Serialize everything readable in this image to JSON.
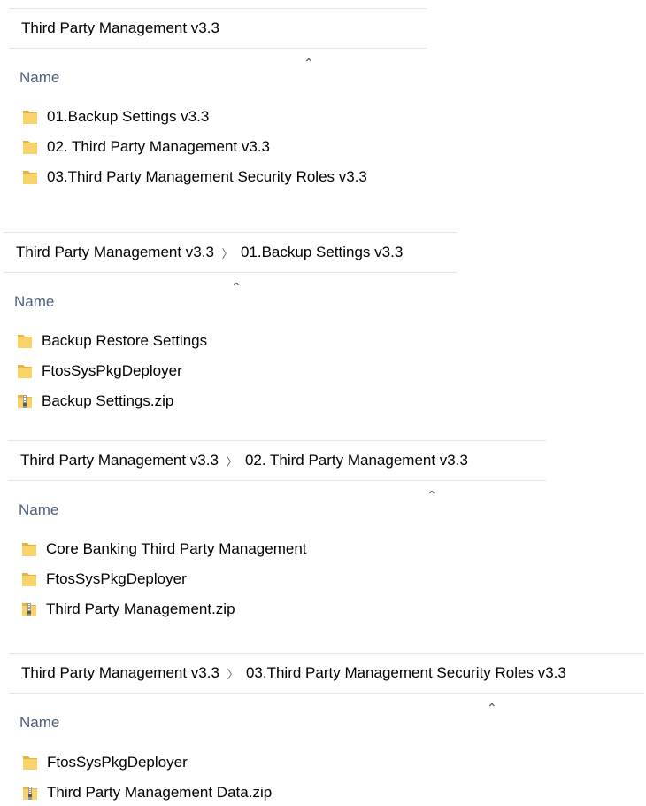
{
  "panel1": {
    "breadcrumb": [
      "Third Party Management v3.3"
    ],
    "header": "Name",
    "items": [
      {
        "icon": "folder-icon",
        "name": "01.Backup Settings v3.3"
      },
      {
        "icon": "folder-icon",
        "name": "02. Third Party Management v3.3"
      },
      {
        "icon": "folder-icon",
        "name": "03.Third Party Management Security Roles v3.3"
      }
    ]
  },
  "panel2": {
    "breadcrumb": [
      "Third Party Management v3.3",
      "01.Backup Settings v3.3"
    ],
    "header": "Name",
    "items": [
      {
        "icon": "folder-icon",
        "name": "Backup Restore Settings"
      },
      {
        "icon": "folder-icon",
        "name": "FtosSysPkgDeployer"
      },
      {
        "icon": "zip-folder-icon",
        "name": "Backup Settings.zip"
      }
    ]
  },
  "panel3": {
    "breadcrumb": [
      "Third Party Management v3.3",
      "02. Third Party Management v3.3"
    ],
    "header": "Name",
    "items": [
      {
        "icon": "folder-icon",
        "name": "Core Banking Third Party Management"
      },
      {
        "icon": "folder-icon",
        "name": "FtosSysPkgDeployer"
      },
      {
        "icon": "zip-folder-icon",
        "name": "Third Party Management.zip"
      }
    ]
  },
  "panel4": {
    "breadcrumb": [
      "Third Party Management v3.3",
      "03.Third Party Management Security Roles v3.3"
    ],
    "header": "Name",
    "items": [
      {
        "icon": "folder-icon",
        "name": "FtosSysPkgDeployer"
      },
      {
        "icon": "zip-folder-icon",
        "name": "Third Party Management Data.zip"
      }
    ]
  },
  "colors": {
    "folder": "#f8d36b",
    "folder_dark": "#e6b43c",
    "header_text": "#4c607a",
    "border": "#e3e3e3"
  }
}
